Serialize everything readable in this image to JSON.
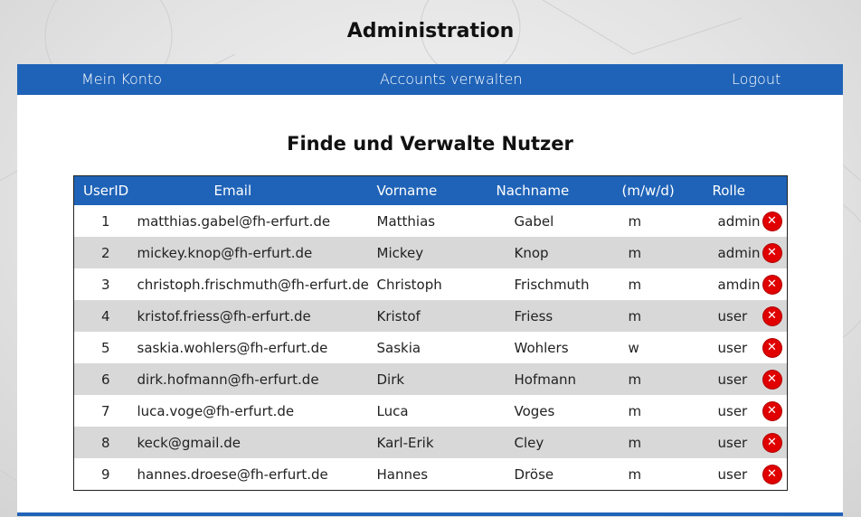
{
  "site": {
    "title": "Administration"
  },
  "nav": {
    "my_account": "Mein Konto",
    "manage_accounts": "Accounts verwalten",
    "logout": "Logout"
  },
  "main": {
    "heading": "Finde und Verwalte Nutzer"
  },
  "table": {
    "columns": [
      "UserID",
      "Email",
      "Vorname",
      "Nachname",
      "(m/w/d)",
      "Rolle"
    ],
    "rows": [
      {
        "id": "1",
        "email": "matthias.gabel@fh-erfurt.de",
        "first": "Matthias",
        "last": "Gabel",
        "gender": "m",
        "role": "admin"
      },
      {
        "id": "2",
        "email": "mickey.knop@fh-erfurt.de",
        "first": "Mickey",
        "last": "Knop",
        "gender": "m",
        "role": "admin"
      },
      {
        "id": "3",
        "email": "christoph.frischmuth@fh-erfurt.de",
        "first": "Christoph",
        "last": "Frischmuth",
        "gender": "m",
        "role": "amdin"
      },
      {
        "id": "4",
        "email": "kristof.friess@fh-erfurt.de",
        "first": "Kristof",
        "last": "Friess",
        "gender": "m",
        "role": "user"
      },
      {
        "id": "5",
        "email": "saskia.wohlers@fh-erfurt.de",
        "first": "Saskia",
        "last": "Wohlers",
        "gender": "w",
        "role": "user"
      },
      {
        "id": "6",
        "email": "dirk.hofmann@fh-erfurt.de",
        "first": "Dirk",
        "last": "Hofmann",
        "gender": "m",
        "role": "user"
      },
      {
        "id": "7",
        "email": "luca.voge@fh-erfurt.de",
        "first": "Luca",
        "last": "Voges",
        "gender": "m",
        "role": "user"
      },
      {
        "id": "8",
        "email": "keck@gmail.de",
        "first": "Karl-Erik",
        "last": "Cley",
        "gender": "m",
        "role": "user"
      },
      {
        "id": "9",
        "email": "hannes.droese@fh-erfurt.de",
        "first": "Hannes",
        "last": "Dröse",
        "gender": "m",
        "role": "user"
      }
    ],
    "delete_icon": "close-circle-icon"
  },
  "colors": {
    "accent": "#1f63b8",
    "delete": "#e00000",
    "row_alt": "#d8d8d8"
  }
}
